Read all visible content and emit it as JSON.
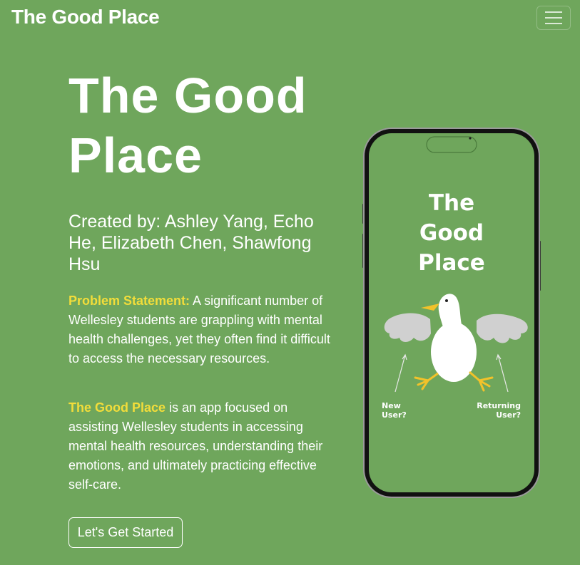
{
  "navbar": {
    "brand": "The Good Place",
    "menu_icon": "hamburger-menu-icon"
  },
  "hero": {
    "title": "The Good\nPlace",
    "credits": "Created by: Ashley Yang, Echo He, Elizabeth Chen, Shawfong Hsu",
    "problem_label": "Problem Statement:",
    "problem_text": " A significant number of Wellesley students are grappling with mental health challenges, yet they often find it difficult to access the necessary resources.",
    "app_label": "The Good Place",
    "app_text": " is an app focused on assisting Wellesley students in accessing mental health resources, understanding their emotions, and ultimately practicing effective self-care.",
    "cta_label": "Let's Get Started"
  },
  "phone_mockup": {
    "screen_title": "The\nGood\nPlace",
    "new_user_label": "New\nUser?",
    "returning_user_label": "Returning\nUser?",
    "mascot_icon": "goose-icon"
  },
  "colors": {
    "background": "#6fa65c",
    "accent": "#f2dd3a",
    "text": "#ffffff"
  }
}
